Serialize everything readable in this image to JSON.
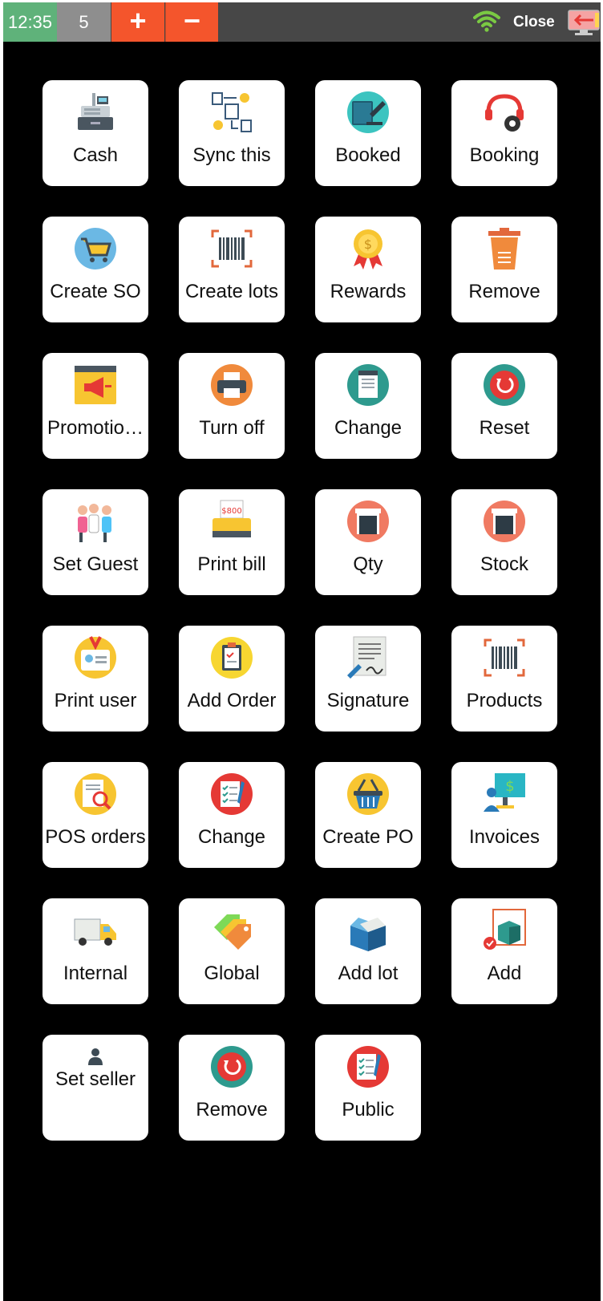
{
  "topbar": {
    "time": "12:35",
    "count": "5",
    "plus": "+",
    "minus": "−",
    "close_label": "Close",
    "colors": {
      "time_bg": "#5fb27a",
      "count_bg": "#8e8e8e",
      "accent": "#f4552c",
      "bar_bg": "#474747",
      "wifi": "#7ac943"
    }
  },
  "tiles": [
    {
      "label": "Cash",
      "icon": "cash-register-icon"
    },
    {
      "label": "Sync this",
      "icon": "sync-flow-icon"
    },
    {
      "label": "Booked",
      "icon": "booked-book-icon"
    },
    {
      "label": "Booking",
      "icon": "headset-gear-icon"
    },
    {
      "label": "Create SO",
      "icon": "shopping-cart-icon"
    },
    {
      "label": "Create lots",
      "icon": "barcode-scan-icon"
    },
    {
      "label": "Rewards",
      "icon": "reward-medal-icon"
    },
    {
      "label": "Remove",
      "icon": "trash-bin-icon"
    },
    {
      "label": "Promotio…",
      "icon": "megaphone-icon"
    },
    {
      "label": "Turn off",
      "icon": "printer-icon"
    },
    {
      "label": "Change",
      "icon": "taxes-receipt-icon"
    },
    {
      "label": "Reset",
      "icon": "reset-circle-icon"
    },
    {
      "label": "Set Guest",
      "icon": "guests-group-icon"
    },
    {
      "label": "Print bill",
      "icon": "bill-printer-icon"
    },
    {
      "label": "Qty",
      "icon": "store-door-icon"
    },
    {
      "label": "Stock",
      "icon": "store-door-icon"
    },
    {
      "label": "Print user",
      "icon": "id-badge-icon"
    },
    {
      "label": "Add Order",
      "icon": "clipboard-icon"
    },
    {
      "label": "Signature",
      "icon": "signature-document-icon"
    },
    {
      "label": "Products",
      "icon": "barcode-scan-icon"
    },
    {
      "label": "POS orders",
      "icon": "report-search-icon"
    },
    {
      "label": "Change",
      "icon": "checklist-icon"
    },
    {
      "label": "Create PO",
      "icon": "shopping-basket-icon"
    },
    {
      "label": "Invoices",
      "icon": "invoice-monitor-icon"
    },
    {
      "label": "Internal",
      "icon": "delivery-truck-icon"
    },
    {
      "label": "Global",
      "icon": "price-tags-icon"
    },
    {
      "label": "Add lot",
      "icon": "open-box-icon"
    },
    {
      "label": "Add",
      "icon": "package-add-icon"
    },
    {
      "label": "Set seller",
      "icon": "person-icon"
    },
    {
      "label": "Remove",
      "icon": "reset-circle-icon"
    },
    {
      "label": "Public",
      "icon": "checklist-icon"
    }
  ]
}
